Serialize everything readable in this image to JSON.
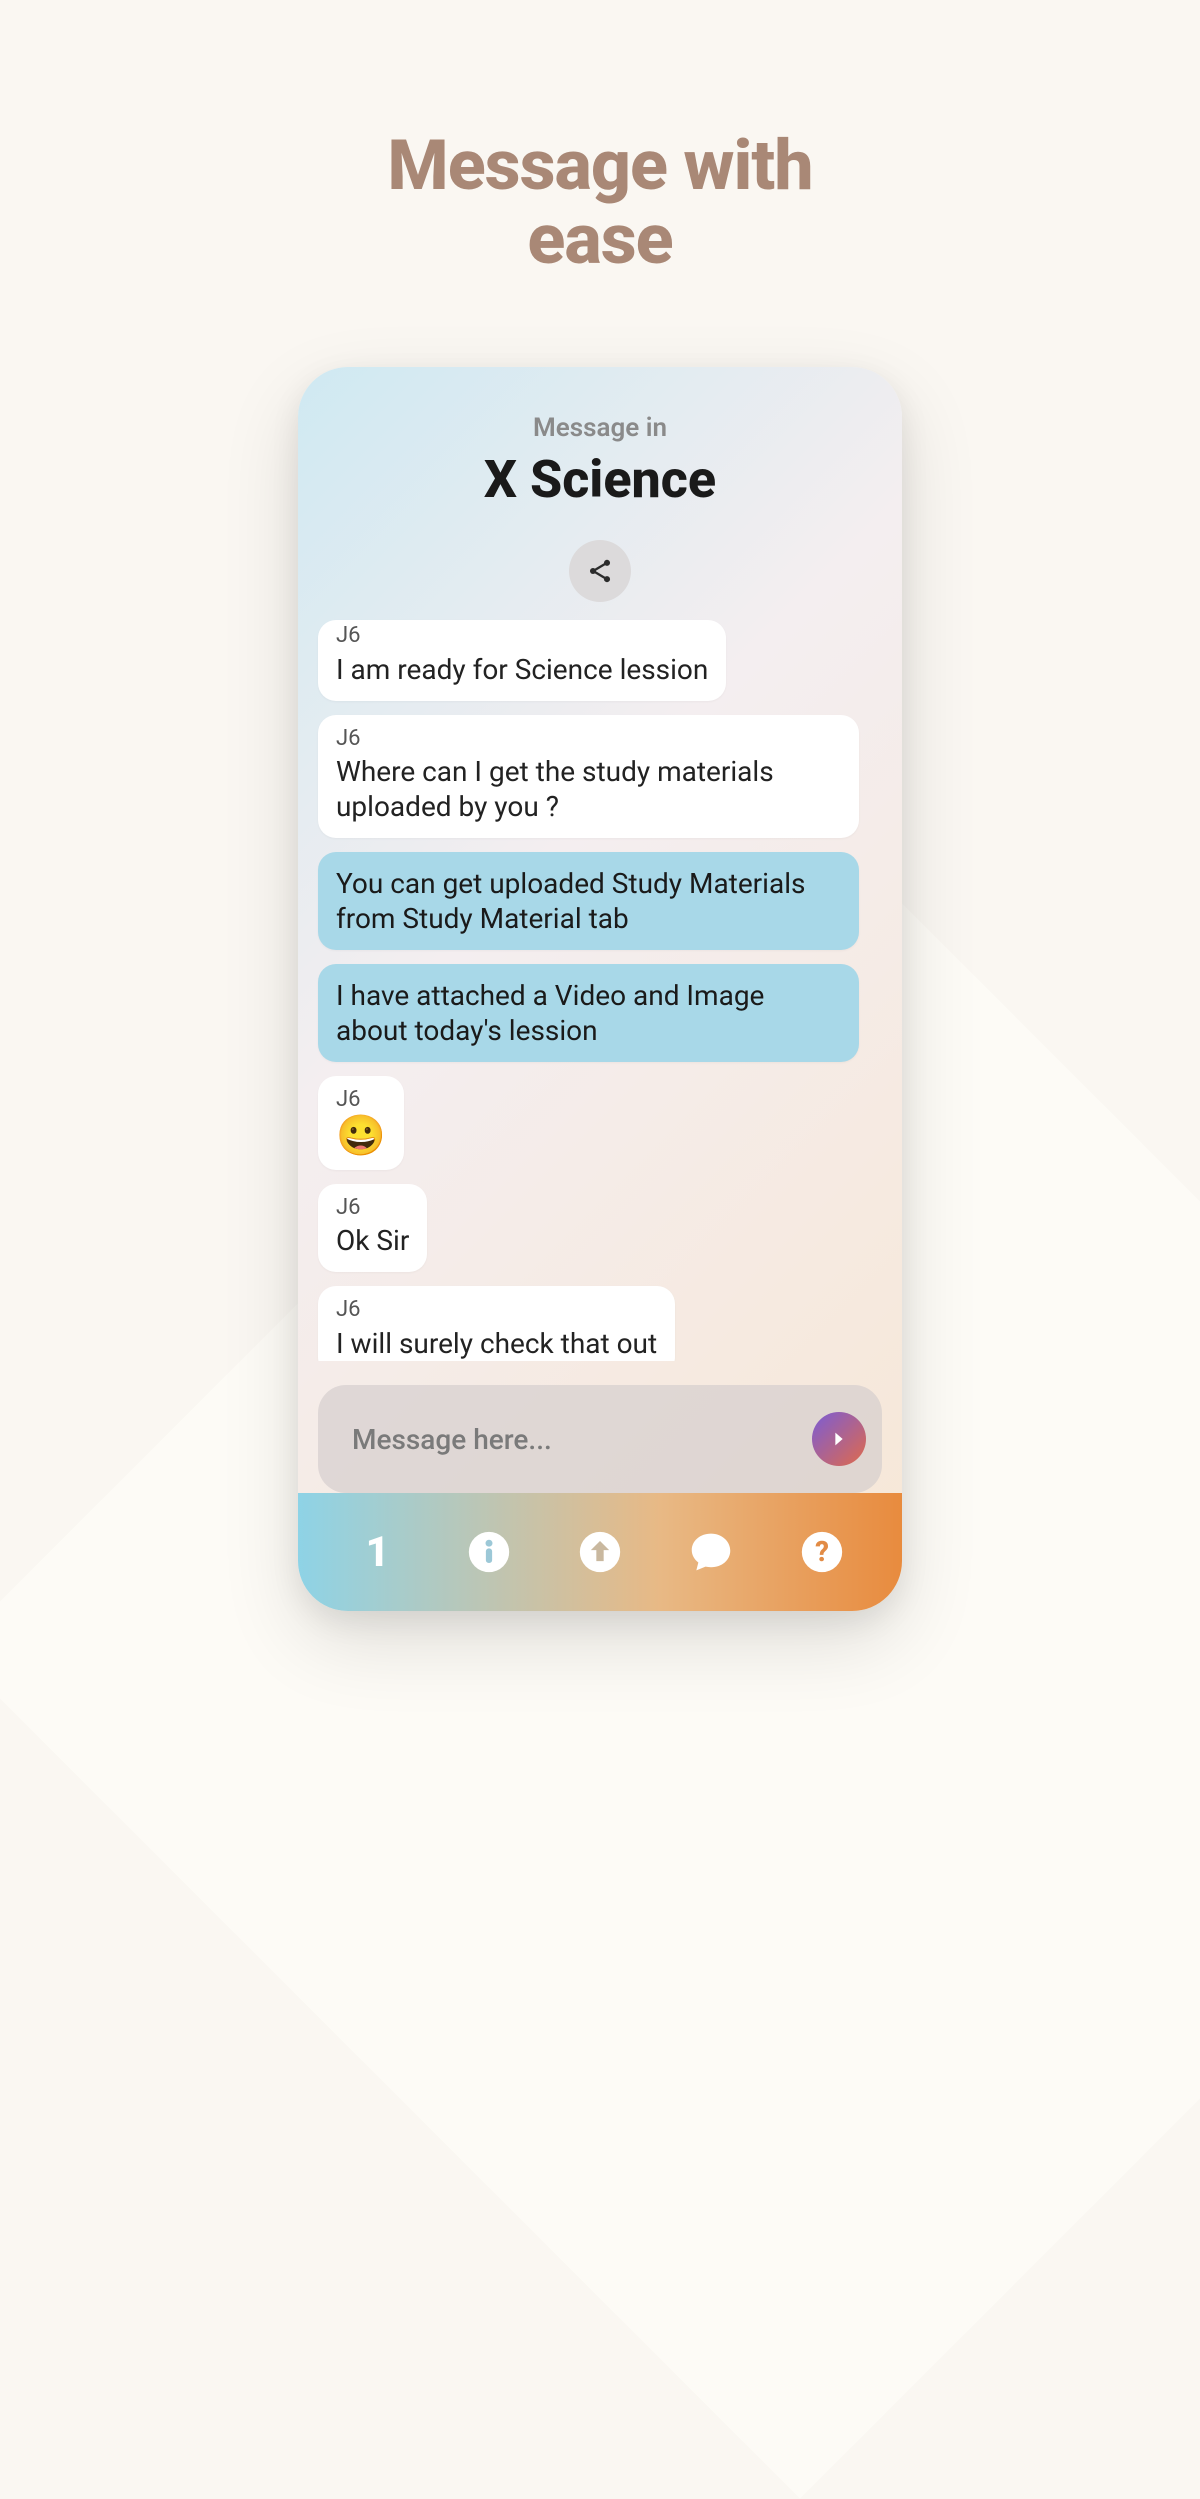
{
  "page": {
    "title_line1": "Message with",
    "title_line2": "ease"
  },
  "phone": {
    "header_sub": "Message in",
    "header_title": "X Science"
  },
  "messages": [
    {
      "side": "in",
      "sender": "J6",
      "text": "I am ready for Science lession",
      "clipped": true
    },
    {
      "side": "in",
      "sender": "J6",
      "text": "Where can I get the study materials uploaded by you ?"
    },
    {
      "side": "out",
      "text": "You can get uploaded Study Materials from Study Material tab"
    },
    {
      "side": "out",
      "text": "I have attached a Video and Image about today's lession"
    },
    {
      "side": "in",
      "sender": "J6",
      "text": "😀",
      "emoji": true
    },
    {
      "side": "in",
      "sender": "J6",
      "text": "Ok Sir"
    },
    {
      "side": "in",
      "sender": "J6",
      "text": "I will surely check that out"
    }
  ],
  "composer": {
    "placeholder": "Message here..."
  },
  "nav": {
    "first_label": "1"
  },
  "icons": {
    "share": "share-icon",
    "send": "send-icon",
    "info": "info-icon",
    "upload": "upload-icon",
    "chat": "chat-icon",
    "help": "help-icon"
  }
}
